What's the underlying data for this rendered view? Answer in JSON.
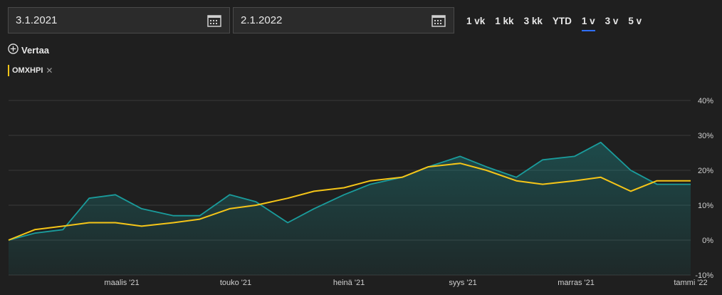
{
  "date_from": {
    "value": "3.1.2021",
    "icon": "calendar-icon"
  },
  "date_to": {
    "value": "2.1.2022",
    "icon": "calendar-icon"
  },
  "ranges": [
    "1 vk",
    "1 kk",
    "3 kk",
    "YTD",
    "1 v",
    "3 v",
    "5 v"
  ],
  "active_range": "1 v",
  "compare": {
    "label": "Vertaa",
    "icon": "plus-circle-icon"
  },
  "series_tag": {
    "label": "OMXHPI",
    "close": "✕",
    "color": "#f5c518"
  },
  "chart_data": {
    "type": "line",
    "title": "",
    "ylim": [
      -10,
      40
    ],
    "yticks": [
      40,
      30,
      20,
      10,
      0,
      -10
    ],
    "ytick_labels": [
      "40%",
      "30%",
      "20%",
      "10%",
      "0%",
      "-10%"
    ],
    "xticks": [
      {
        "label": "maalis '21",
        "t": 0.166
      },
      {
        "label": "touko '21",
        "t": 0.333
      },
      {
        "label": "heinä '21",
        "t": 0.499
      },
      {
        "label": "syys '21",
        "t": 0.666
      },
      {
        "label": "marras '21",
        "t": 0.832
      },
      {
        "label": "tammi '22",
        "t": 1.0
      }
    ],
    "x": [
      "2021-01-03",
      "2021-01-17",
      "2021-02-01",
      "2021-02-15",
      "2021-03-01",
      "2021-03-15",
      "2021-04-01",
      "2021-04-15",
      "2021-05-01",
      "2021-05-15",
      "2021-06-01",
      "2021-06-15",
      "2021-07-01",
      "2021-07-15",
      "2021-08-01",
      "2021-08-15",
      "2021-09-01",
      "2021-09-15",
      "2021-10-01",
      "2021-10-15",
      "2021-11-01",
      "2021-11-15",
      "2021-12-01",
      "2021-12-15",
      "2022-01-02"
    ],
    "series": [
      {
        "color": "#1a9c9c",
        "values": [
          0,
          2,
          3,
          12,
          13,
          9,
          7,
          7,
          13,
          11,
          5,
          9,
          13,
          16,
          18,
          21,
          24,
          21,
          18,
          23,
          24,
          28,
          20,
          16,
          16
        ]
      },
      {
        "color": "#f5c518",
        "values": [
          0,
          3,
          4,
          5,
          5,
          4,
          5,
          6,
          9,
          10,
          12,
          14,
          15,
          17,
          18,
          21,
          22,
          20,
          17,
          16,
          17,
          18,
          14,
          17,
          17
        ]
      }
    ]
  }
}
